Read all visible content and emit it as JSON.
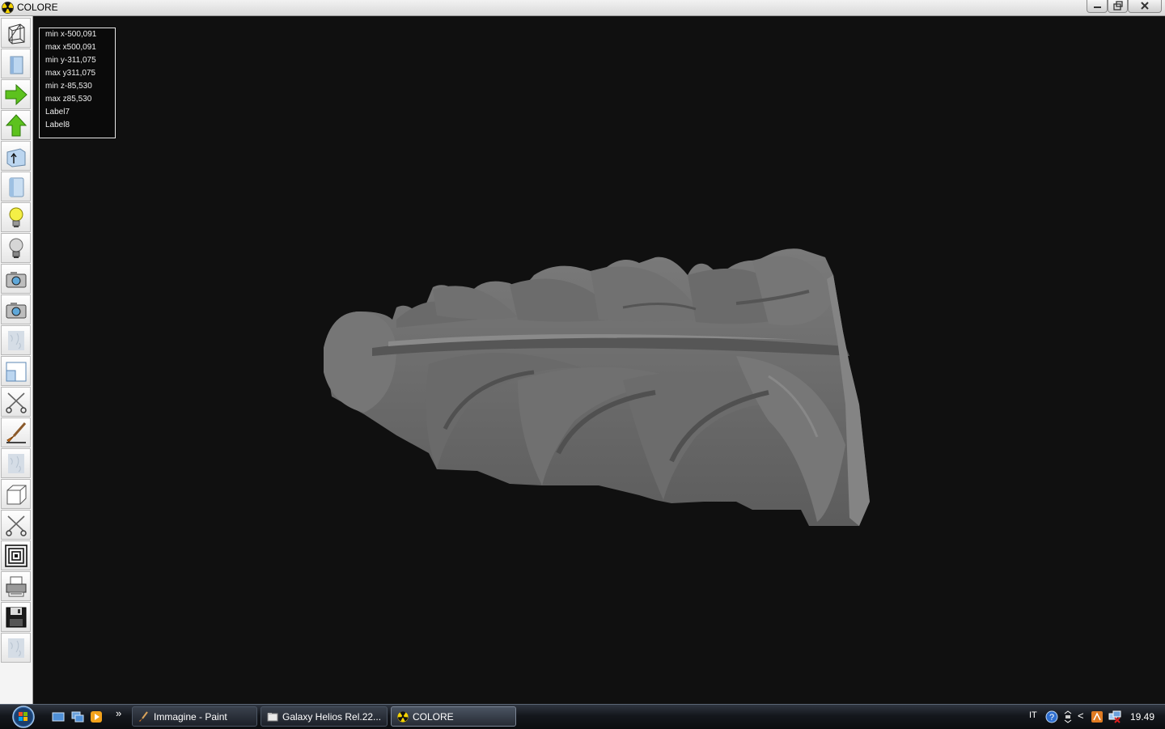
{
  "window": {
    "title": "COLORE"
  },
  "infobox": {
    "lines": [
      "min x-500,091",
      "max x500,091",
      "min y-311,075",
      "max y311,075",
      "min z-85,530",
      "max z85,530",
      "Label7",
      "Label8"
    ]
  },
  "toolbar": {
    "icons": [
      "wireframe-box-icon",
      "shaded-box-icon",
      "arrow-right-icon",
      "arrow-up-icon",
      "box-arrow-icon",
      "cylinder-icon",
      "light-on-icon",
      "light-off-icon",
      "camera-icon",
      "camera-2-icon",
      "texture-icon",
      "resize-window-icon",
      "scissors-icon",
      "brush-icon",
      "texture-2-icon",
      "cube-icon",
      "scissors-2-icon",
      "concentric-squares-icon",
      "printer-icon",
      "save-icon",
      "texture-3-icon"
    ]
  },
  "taskbar": {
    "tasks": [
      {
        "label": "Immagine - Paint",
        "icon": "paint-icon"
      },
      {
        "label": "Galaxy Helios  Rel.22...",
        "icon": "folder-icon"
      },
      {
        "label": "COLORE",
        "icon": "radiation-icon"
      }
    ],
    "language": "IT",
    "clock": "19.49",
    "overflow_glyph": "»",
    "tray_arrow": "<"
  },
  "colors": {
    "viewport_bg": "#101010",
    "model_gray": "#6e6e6e",
    "arrow_green": "#5dc21e"
  }
}
